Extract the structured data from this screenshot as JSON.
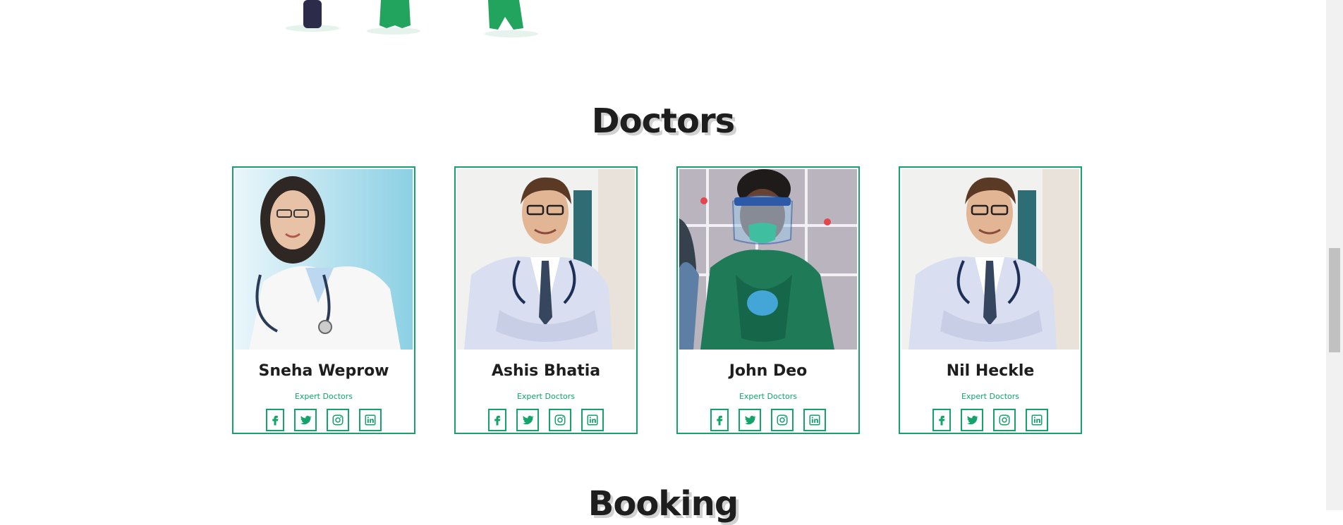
{
  "illustration": {
    "label": "medical-staff-illustration"
  },
  "doctors_section": {
    "title": "Doctors",
    "cards": [
      {
        "name": "Sneha Weprow",
        "role": "Expert Doctors",
        "photo": "female-doctor-photo"
      },
      {
        "name": "Ashis Bhatia",
        "role": "Expert Doctors",
        "photo": "male-doctor-photo"
      },
      {
        "name": "John Deo",
        "role": "Expert Doctors",
        "photo": "doctor-with-face-shield-photo"
      },
      {
        "name": "Nil Heckle",
        "role": "Expert Doctors",
        "photo": "male-doctor-photo"
      }
    ],
    "social_icons": [
      "facebook-icon",
      "twitter-icon",
      "instagram-icon",
      "linkedin-icon"
    ]
  },
  "booking_section": {
    "title": "Booking"
  },
  "colors": {
    "accent": "#13a36b",
    "text": "#1e1e1e"
  }
}
